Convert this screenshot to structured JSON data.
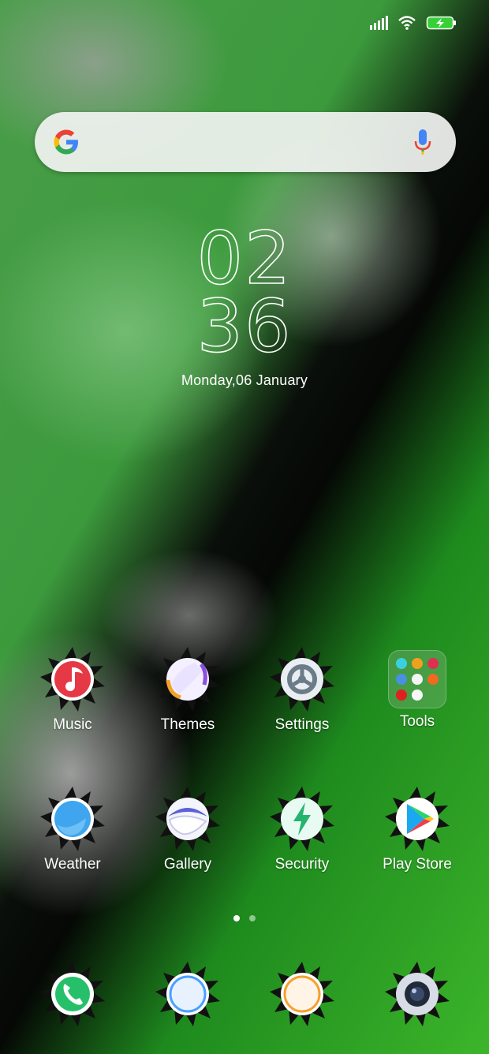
{
  "status_bar": {
    "signal": "signal-icon",
    "wifi": "wifi-icon",
    "battery": "battery-charging-icon"
  },
  "search": {
    "logo": "google-g-icon",
    "mic": "mic-icon"
  },
  "clock": {
    "hour": "02",
    "minute": "36",
    "date": "Monday,06 January"
  },
  "apps_row1": [
    {
      "label": "Music",
      "icon": "music-icon"
    },
    {
      "label": "Themes",
      "icon": "themes-icon"
    },
    {
      "label": "Settings",
      "icon": "settings-icon"
    },
    {
      "label": "Tools",
      "icon": "tools-folder-icon"
    }
  ],
  "apps_row2": [
    {
      "label": "Weather",
      "icon": "weather-icon"
    },
    {
      "label": "Gallery",
      "icon": "gallery-icon"
    },
    {
      "label": "Security",
      "icon": "security-icon"
    },
    {
      "label": "Play Store",
      "icon": "play-store-icon"
    }
  ],
  "dock": [
    {
      "icon": "phone-icon"
    },
    {
      "icon": "messages-icon"
    },
    {
      "icon": "browser-icon"
    },
    {
      "icon": "camera-icon"
    }
  ],
  "page_indicator": {
    "pages": 2,
    "current": 1
  }
}
